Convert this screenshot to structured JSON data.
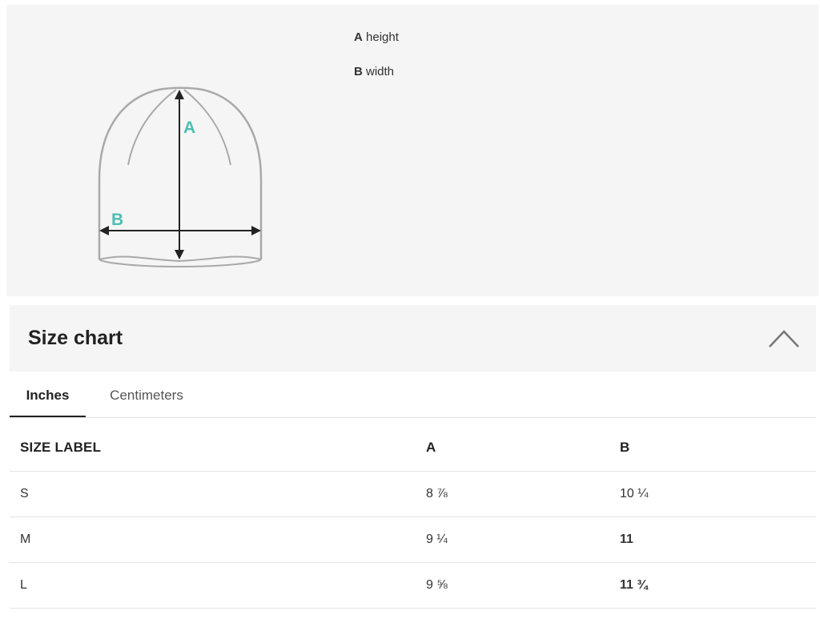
{
  "diagram": {
    "label_a": "A",
    "label_b": "B",
    "accent_color": "#4dbfb0",
    "legend": [
      {
        "key": "A",
        "text": " height"
      },
      {
        "key": "B",
        "text": " width"
      }
    ]
  },
  "size_chart": {
    "title": "Size chart",
    "collapse_icon": "chevron-up-icon"
  },
  "tabs": [
    {
      "label": "Inches",
      "active": true
    },
    {
      "label": "Centimeters",
      "active": false
    }
  ],
  "table": {
    "headers": [
      "SIZE LABEL",
      "A",
      "B"
    ],
    "rows": [
      {
        "size": "S",
        "a": "8 ⅞",
        "b": "10 ¼"
      },
      {
        "size": "M",
        "a": "9 ¼",
        "b": "11"
      },
      {
        "size": "L",
        "a": "9 ⅝",
        "b": "11 ¾"
      }
    ]
  }
}
